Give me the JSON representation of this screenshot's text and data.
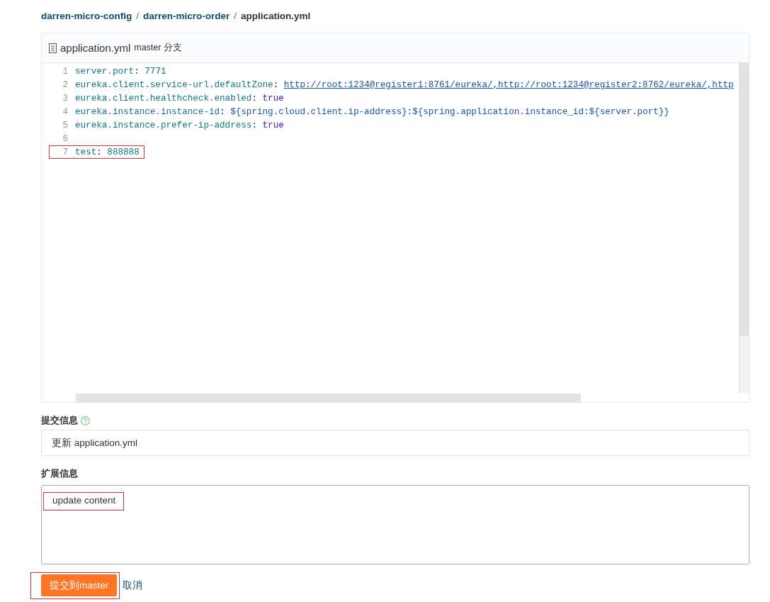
{
  "breadcrumb": [
    {
      "text": "darren-micro-config",
      "kind": "link"
    },
    {
      "text": "/",
      "kind": "separator"
    },
    {
      "text": "darren-micro-order",
      "kind": "link"
    },
    {
      "text": "/",
      "kind": "separator"
    },
    {
      "text": "application.yml",
      "kind": "current"
    }
  ],
  "file": {
    "name": "application.yml",
    "branch": "master",
    "branch_suffix": "分支"
  },
  "code_lines": [
    {
      "number": "1",
      "highlighted": false,
      "segments": [
        {
          "kind": "key",
          "text": "server.port"
        },
        {
          "kind": "punct",
          "text": ": "
        },
        {
          "kind": "number",
          "text": "7771"
        }
      ]
    },
    {
      "number": "2",
      "highlighted": false,
      "segments": [
        {
          "kind": "key",
          "text": "eureka.client.service-url.defaultZone"
        },
        {
          "kind": "punct",
          "text": ": "
        },
        {
          "kind": "link",
          "text": "http://root:1234@register1:8761/eureka/,http://root:1234@register2:8762/eureka/,http"
        }
      ]
    },
    {
      "number": "3",
      "highlighted": false,
      "segments": [
        {
          "kind": "key",
          "text": "eureka.client.healthcheck.enabled"
        },
        {
          "kind": "punct",
          "text": ": "
        },
        {
          "kind": "bool",
          "text": "true"
        }
      ]
    },
    {
      "number": "4",
      "highlighted": false,
      "segments": [
        {
          "kind": "key",
          "text": "eureka.instance.instance-id"
        },
        {
          "kind": "punct",
          "text": ": "
        },
        {
          "kind": "text",
          "text": "${spring.cloud.client.ip-address}:${spring.application.instance_id:${server.port}}"
        }
      ]
    },
    {
      "number": "5",
      "highlighted": false,
      "segments": [
        {
          "kind": "key",
          "text": "eureka.instance.prefer-ip-address"
        },
        {
          "kind": "punct",
          "text": ": "
        },
        {
          "kind": "bool",
          "text": "true"
        }
      ]
    },
    {
      "number": "6",
      "highlighted": false
    },
    {
      "number": "7",
      "highlighted": true,
      "segments": [
        {
          "kind": "key",
          "text": "test"
        },
        {
          "kind": "punct",
          "text": ": "
        },
        {
          "kind": "number",
          "text": "888888"
        }
      ]
    }
  ],
  "commit_message": {
    "label": "提交信息",
    "value": "更新 application.yml"
  },
  "extended_info": {
    "label": "扩展信息",
    "value": "update content",
    "highlighted": true
  },
  "submit_button": {
    "label": "提交到master",
    "highlighted": true
  },
  "cancel_link": "取消"
}
